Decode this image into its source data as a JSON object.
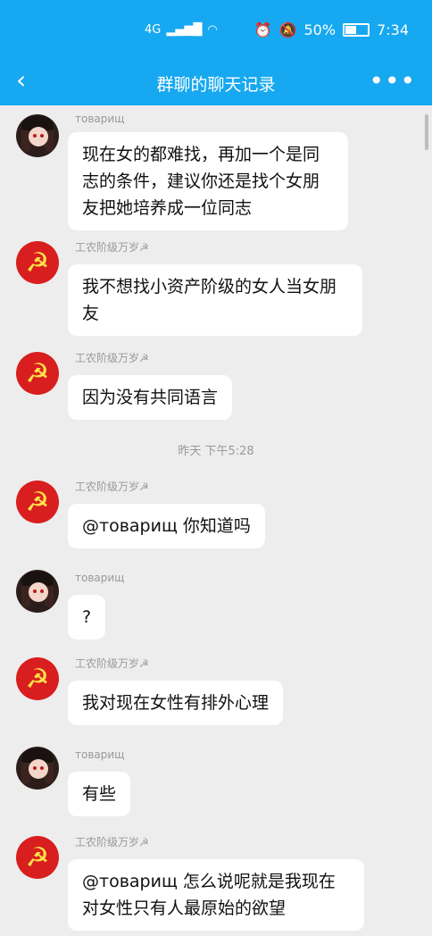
{
  "status": {
    "network": "4G",
    "signal": "▂▄▆█",
    "wifi": "wifi",
    "battery": "50%",
    "time": "7:34"
  },
  "header": {
    "title": "群聊的聊天记录",
    "back": "‹",
    "more": "•••"
  },
  "colors": {
    "accent": "#16a8f0",
    "background": "#ededed",
    "bubble": "#ffffff",
    "party_red": "#d81e1e"
  },
  "messages": [
    {
      "sender": "товарищ",
      "avatar": "girl-avatar",
      "text": "现在女的都难找，再加一个是同志的条件，建议你还是找个女朋友把她培养成一位同志"
    },
    {
      "sender": "工农阶级万岁☭",
      "avatar": "hammer-sickle-avatar",
      "text": "我不想找小资产阶级的女人当女朋友"
    },
    {
      "sender": "工农阶级万岁☭",
      "avatar": "hammer-sickle-avatar",
      "text": "因为没有共同语言"
    },
    {
      "timestamp": "昨天 下午5:28"
    },
    {
      "sender": "工农阶级万岁☭",
      "avatar": "hammer-sickle-avatar",
      "text": "@товарищ 你知道吗"
    },
    {
      "sender": "товарищ",
      "avatar": "girl-avatar",
      "text": "?"
    },
    {
      "sender": "工农阶级万岁☭",
      "avatar": "hammer-sickle-avatar",
      "text": "我对现在女性有排外心理"
    },
    {
      "sender": "товарищ",
      "avatar": "girl-avatar",
      "text": "有些"
    },
    {
      "sender": "工农阶级万岁☭",
      "avatar": "hammer-sickle-avatar",
      "text": "@товарищ 怎么说呢就是我现在对女性只有人最原始的欲望"
    }
  ]
}
